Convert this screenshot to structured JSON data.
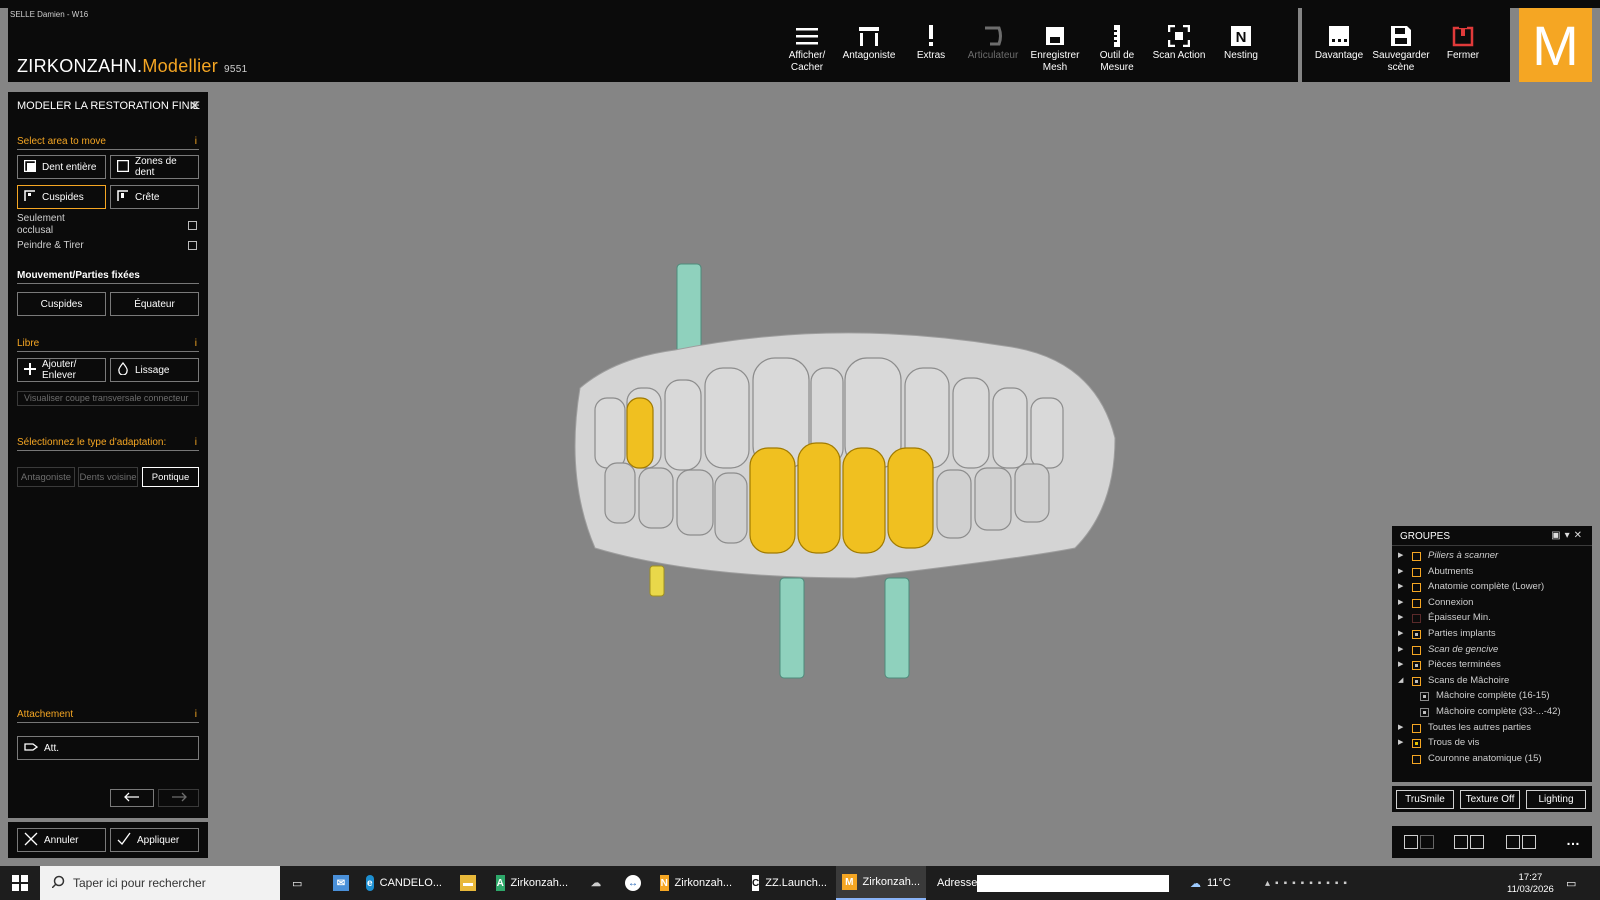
{
  "window": {
    "title": "SELLE Damien - W16"
  },
  "brand": {
    "part1": "ZIRKONZAHN.",
    "part2": "Modellier",
    "version": "9551"
  },
  "toolbar": {
    "items": [
      {
        "label": "Afficher/\nCacher",
        "icon": "hamburger-icon"
      },
      {
        "label": "Antagoniste",
        "icon": "antagonist-icon"
      },
      {
        "label": "Extras",
        "icon": "exclamation-icon"
      },
      {
        "label": "Articulateur",
        "icon": "articulator-icon",
        "disabled": true
      },
      {
        "label": "Enregistrer\nMesh",
        "icon": "save-mesh-icon"
      },
      {
        "label": "Outil de\nMesure",
        "icon": "ruler-icon"
      },
      {
        "label": "Scan Action",
        "icon": "scan-icon"
      },
      {
        "label": "Nesting",
        "icon": "nesting-icon"
      }
    ],
    "right_items": [
      {
        "label": "Davantage",
        "icon": "more-icon"
      },
      {
        "label": "Sauvegarder\nscène",
        "icon": "save-icon"
      },
      {
        "label": "Fermer",
        "icon": "power-icon"
      }
    ],
    "logo_letter": "M"
  },
  "left_panel": {
    "title": "MODELER LA RESTORATION FINIE",
    "select_area": {
      "label": "Select area to move",
      "buttons": [
        "Dent entière",
        "Zones de\ndent",
        "Cuspides",
        "Crête"
      ],
      "checks": [
        "Seulement\nocclusal",
        "Peindre & Tirer"
      ]
    },
    "mouvement": {
      "label": "Mouvement/Parties fixées",
      "buttons": [
        "Cuspides",
        "Équateur"
      ]
    },
    "libre": {
      "label": "Libre",
      "buttons": [
        "Ajouter/\nEnlever",
        "Lissage"
      ],
      "connector": "Visualiser coupe transversale connecteur"
    },
    "adaptation": {
      "label": "Sélectionnez le type d'adaptation:",
      "buttons": [
        "Antagoniste",
        "Dents voisine",
        "Pontique"
      ]
    },
    "attachement": {
      "label": "Attachement",
      "button": "Att."
    },
    "info_glyph": "i",
    "footer": {
      "cancel": "Annuler",
      "apply": "Appliquer"
    }
  },
  "groups": {
    "title": "GROUPES",
    "items": [
      {
        "label": "Piliers à scanner",
        "italic": true,
        "checked": false
      },
      {
        "label": "Abutments",
        "checked": false
      },
      {
        "label": "Anatomie complète (Lower)",
        "checked": false
      },
      {
        "label": "Connexion",
        "checked": false
      },
      {
        "label": "Épaisseur Min.",
        "checked": false
      },
      {
        "label": "Parties implants",
        "checked": true
      },
      {
        "label": "Scan de gencive",
        "italic": true,
        "checked": false
      },
      {
        "label": "Pièces terminées",
        "checked": true
      },
      {
        "label": "Scans de Mâchoire",
        "checked": true,
        "expanded": true
      },
      {
        "label": "Mâchoire complète (16-15)",
        "sub": true,
        "checked": true
      },
      {
        "label": "Mâchoire complète (33-...-42)",
        "sub": true,
        "checked": true
      },
      {
        "label": "Toutes les autres parties",
        "checked": false
      },
      {
        "label": "Trous de vis",
        "checked": true
      },
      {
        "label": "Couronne anatomique (15)",
        "checked": false,
        "noarrow": true
      }
    ],
    "footer_buttons": [
      "TruSmile",
      "Texture Off",
      "Lighting"
    ]
  },
  "taskbar": {
    "search_placeholder": "Taper ici pour rechercher",
    "apps": [
      "CANDELO...",
      "Zirkonzah...",
      "Zirkonzah...",
      "ZZ.Launch...",
      "Zirkonzah..."
    ],
    "address_label": "Adresse",
    "weather": "11°C",
    "time": "17:27",
    "date": "11/03/2026"
  },
  "colors": {
    "accent": "#f5a623",
    "panel": "#0b0b0b",
    "viewport": "#858585"
  }
}
